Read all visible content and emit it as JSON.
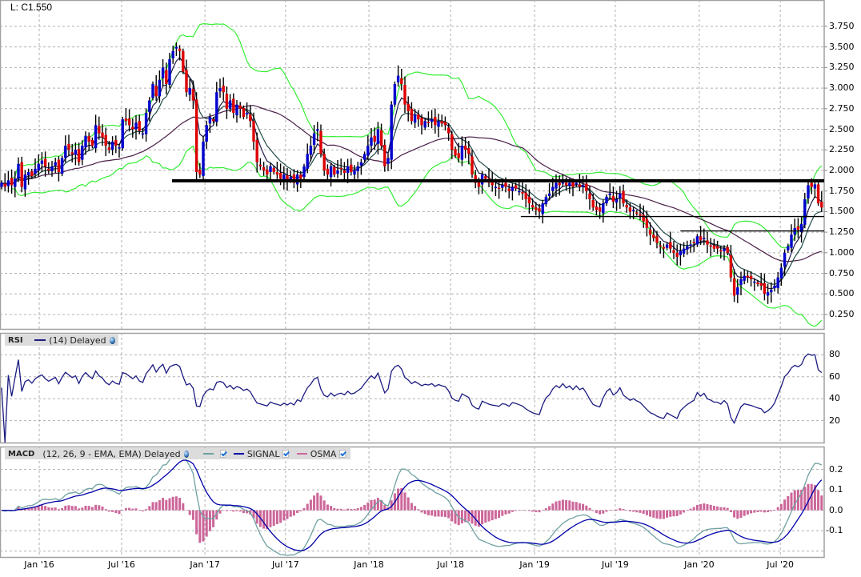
{
  "header": {
    "last_label": "L: C1.550"
  },
  "chart_data": [
    {
      "type": "candlestick",
      "panel": "price",
      "closes": [
        1.85,
        1.8,
        1.88,
        1.82,
        1.9,
        2.08,
        1.8,
        1.95,
        1.98,
        1.93,
        2.02,
        2.08,
        2.12,
        2.05,
        2.0,
        2.05,
        2.1,
        1.98,
        2.15,
        2.3,
        2.25,
        2.2,
        2.25,
        2.1,
        2.3,
        2.42,
        2.35,
        2.3,
        2.55,
        2.45,
        2.4,
        2.3,
        2.25,
        2.35,
        2.3,
        2.28,
        2.62,
        2.6,
        2.55,
        2.5,
        2.58,
        2.48,
        2.45,
        2.7,
        2.85,
        3.05,
        2.9,
        3.1,
        3.25,
        3.05,
        3.35,
        3.45,
        3.5,
        3.45,
        3.2,
        2.95,
        3.0,
        2.85,
        1.98,
        1.95,
        2.35,
        2.55,
        2.65,
        2.6,
        2.95,
        3.0,
        2.95,
        2.75,
        2.85,
        2.7,
        2.8,
        2.75,
        2.65,
        2.7,
        2.6,
        2.35,
        2.1,
        2.05,
        2.0,
        1.95,
        2.05,
        1.98,
        1.95,
        1.9,
        1.95,
        1.88,
        1.92,
        1.85,
        1.95,
        1.9,
        2.05,
        2.2,
        2.3,
        2.45,
        2.5,
        2.2,
        2.0,
        1.95,
        2.05,
        1.95,
        2.0,
        2.02,
        1.97,
        2.05,
        1.98,
        2.0,
        2.05,
        2.1,
        2.2,
        2.3,
        2.4,
        2.35,
        2.5,
        2.3,
        2.05,
        2.15,
        2.8,
        3.05,
        3.15,
        3.05,
        2.8,
        2.72,
        2.6,
        2.68,
        2.62,
        2.55,
        2.6,
        2.58,
        2.62,
        2.55,
        2.6,
        2.57,
        2.55,
        2.45,
        2.25,
        2.18,
        2.15,
        2.3,
        2.25,
        2.2,
        1.95,
        1.85,
        1.8,
        1.95,
        1.9,
        1.85,
        1.82,
        1.8,
        1.78,
        1.82,
        1.8,
        1.75,
        1.8,
        1.78,
        1.75,
        1.72,
        1.65,
        1.6,
        1.55,
        1.52,
        1.5,
        1.6,
        1.68,
        1.72,
        1.8,
        1.85,
        1.82,
        1.88,
        1.82,
        1.85,
        1.8,
        1.85,
        1.8,
        1.82,
        1.75,
        1.65,
        1.55,
        1.52,
        1.5,
        1.6,
        1.68,
        1.72,
        1.62,
        1.65,
        1.72,
        1.6,
        1.55,
        1.5,
        1.52,
        1.48,
        1.45,
        1.38,
        1.3,
        1.22,
        1.18,
        1.12,
        1.08,
        1.05,
        1.1,
        1.05,
        1.0,
        0.95,
        1.02,
        1.05,
        1.08,
        1.1,
        1.12,
        1.2,
        1.15,
        1.18,
        1.1,
        1.08,
        1.05,
        1.05,
        1.02,
        1.05,
        1.0,
        0.7,
        0.48,
        0.58,
        0.68,
        0.72,
        0.7,
        0.68,
        0.65,
        0.62,
        0.6,
        0.5,
        0.52,
        0.55,
        0.6,
        0.7,
        0.82,
        1.0,
        1.08,
        1.22,
        1.3,
        1.28,
        1.35,
        1.65,
        1.82,
        1.8,
        1.83,
        1.6,
        1.55
      ],
      "ylim": [
        0.075,
        4.07
      ],
      "yticks": [
        "3.750",
        "3.500",
        "3.250",
        "3.000",
        "2.750",
        "2.500",
        "2.250",
        "2.000",
        "1.750",
        "1.500",
        "1.250",
        "1.000",
        "0.750",
        "0.500",
        "0.250"
      ],
      "xticks": [
        "Jan '16",
        "Jul '16",
        "Jan '17",
        "Jul '17",
        "Jan '18",
        "Jul '18",
        "Jan '19",
        "Jul '19",
        "Jan '20",
        "Jul '20"
      ],
      "horizontal_lines": [
        {
          "price": 1.875,
          "style": "thick"
        },
        {
          "price": 1.44,
          "style": "thin"
        },
        {
          "price": 1.265,
          "style": "thin"
        }
      ],
      "grid": true,
      "colors": {
        "up": "#0000cc",
        "down": "#dd0000",
        "bands": "#33ee33",
        "ma_short": "#1c1c48",
        "ma_mid": "#1f4a48",
        "ma_long": "#4a1f48"
      }
    },
    {
      "type": "line",
      "panel": "rsi",
      "title": "RSI",
      "params": "(14) Delayed",
      "ylim": [
        0,
        100
      ],
      "yticks": [
        "80",
        "60",
        "40",
        "20"
      ],
      "colors": {
        "line": "#1a1a80"
      }
    },
    {
      "type": "macd",
      "panel": "macd",
      "title": "MACD",
      "params": "(12, 26, 9 - EMA, EMA) Delayed",
      "legend": [
        {
          "name": "",
          "color": "#6fa0a0"
        },
        {
          "name": "SIGNAL",
          "color": "#0000aa"
        },
        {
          "name": "OSMA",
          "color": "#cc6699"
        }
      ],
      "ylim": [
        -0.229,
        0.3125
      ],
      "yticks": [
        "0.2",
        "0.1",
        "0.0",
        "-0.1"
      ]
    }
  ]
}
